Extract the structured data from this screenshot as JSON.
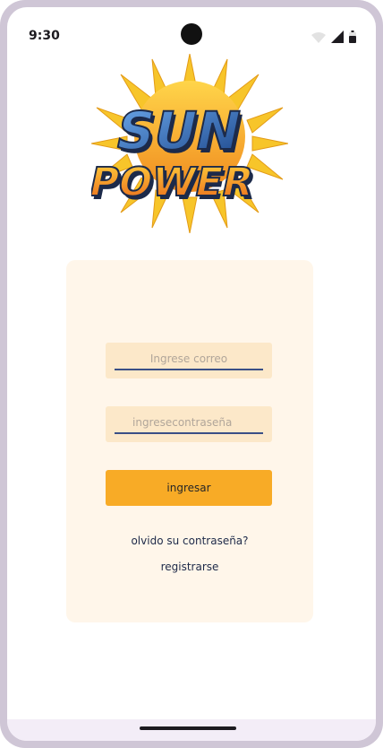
{
  "status_bar": {
    "time": "9:30",
    "icons": [
      "wifi-icon",
      "signal-icon",
      "battery-icon"
    ]
  },
  "logo": {
    "line1": "SUN",
    "line2": "POWER",
    "colors": {
      "sun_rays": "#f7c52a",
      "sun_orange": "#f08a1e",
      "panel_blue": "#2f5fa8",
      "power_orange": "#f39a1e",
      "outline": "#1c2a4a"
    }
  },
  "login_form": {
    "email": {
      "placeholder": "Ingrese correo",
      "value": ""
    },
    "password": {
      "placeholder": "ingresecontraseña",
      "value": ""
    },
    "submit_label": "ingresar",
    "forgot_link": "olvido su contraseña?",
    "register_link": "registrarse"
  },
  "theme": {
    "card_bg": "#fff6ea",
    "field_bg": "#fce8c9",
    "button_bg": "#f8ab26",
    "underline": "#3a4f86"
  }
}
